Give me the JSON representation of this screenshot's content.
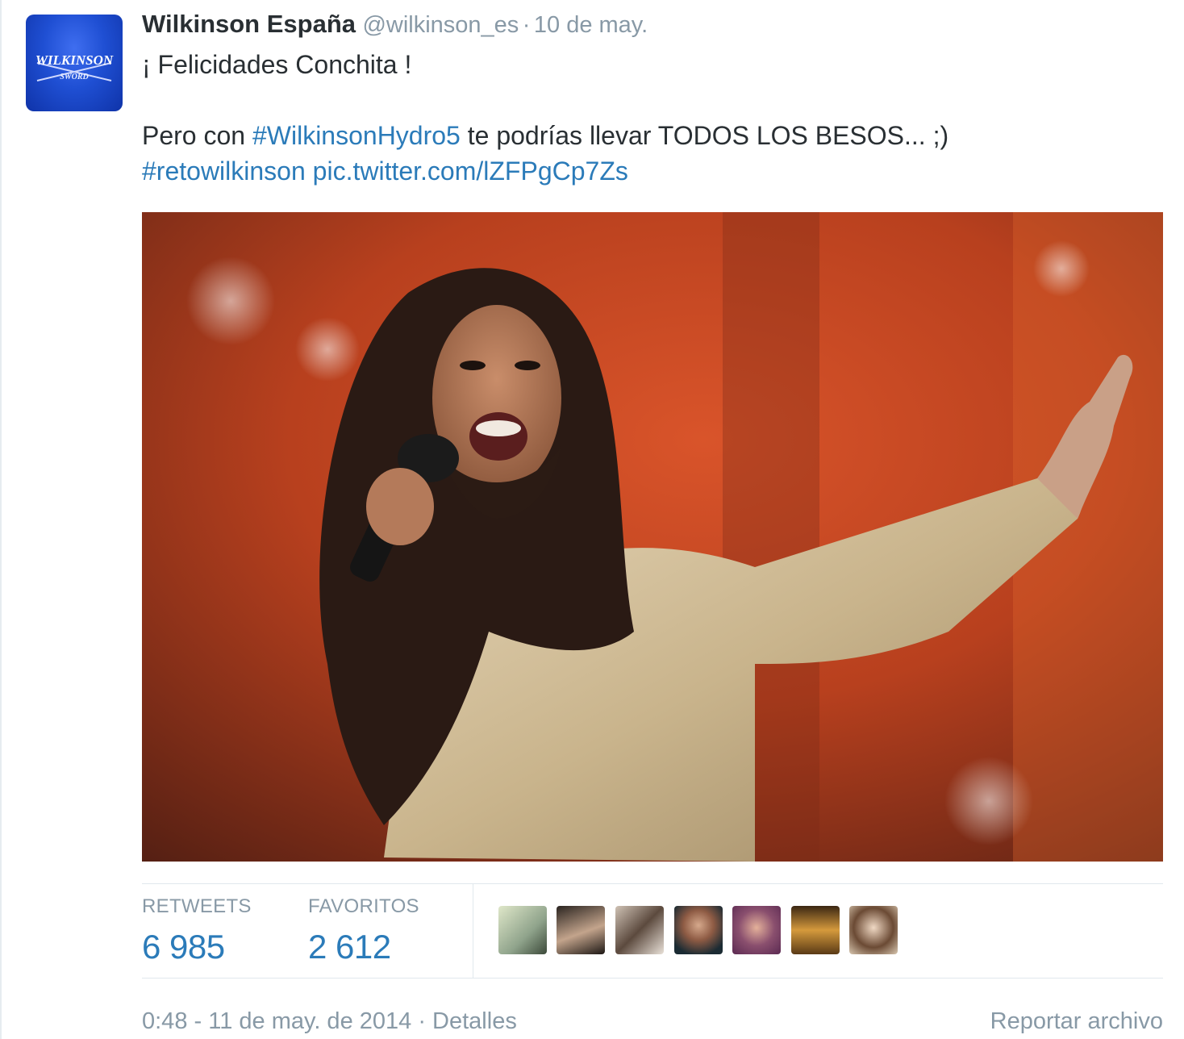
{
  "tweet": {
    "author_name": "Wilkinson España",
    "screen_name": "@wilkinson_es",
    "separator": "·",
    "date": "10 de may.",
    "avatar_text_top": "WILKINSON",
    "avatar_text_bottom": "SWORD",
    "line1": "¡ Felicidades Conchita !",
    "line2_prefix": "Pero con ",
    "line2_hashtag": "#WilkinsonHydro5",
    "line2_suffix": " te podrías llevar TODOS LOS BESOS... ;)",
    "line3_hashtag": "#retowilkinson",
    "line3_space": " ",
    "line3_link": "pic.twitter.com/lZFPgCp7Zs"
  },
  "stats": {
    "retweets_label": "RETWEETS",
    "retweets_value": "6 985",
    "favorites_label": "FAVORITOS",
    "favorites_value": "2 612"
  },
  "footer": {
    "timestamp": "0:48 - 11 de may. de 2014",
    "separator": " · ",
    "details": "Detalles",
    "report": "Reportar archivo"
  },
  "colors": {
    "link": "#2b7bb9",
    "muted": "#8899a6",
    "text": "#292f33",
    "avatar_blue": "#1f4fd3"
  }
}
